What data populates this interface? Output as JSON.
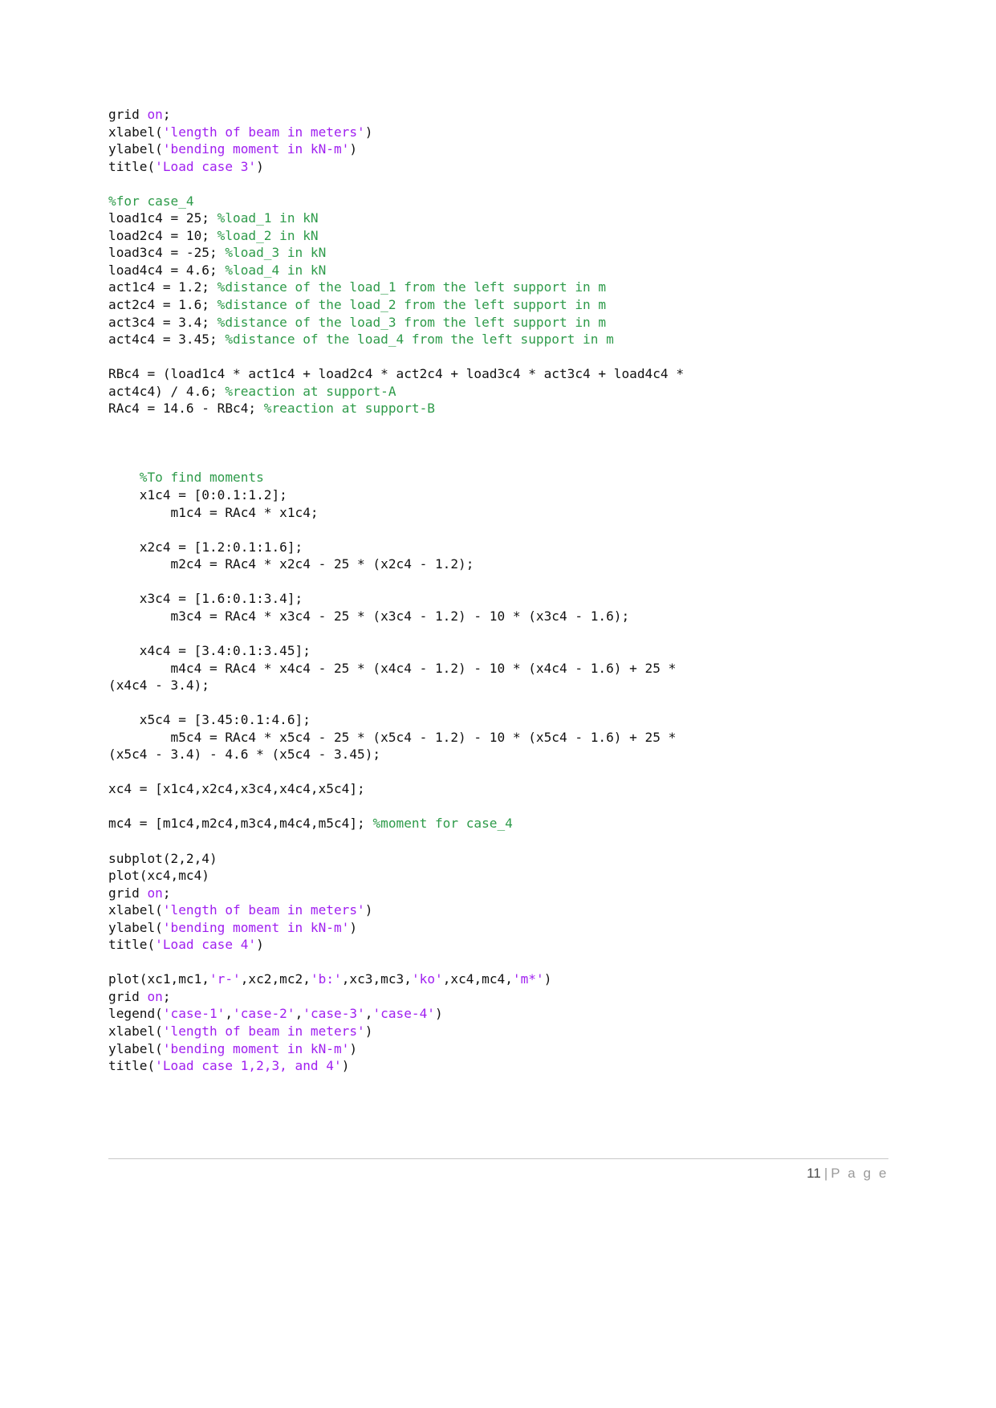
{
  "document": {
    "page_number": "11",
    "footer_separator": "|",
    "footer_label": "P a g e"
  },
  "code": {
    "language": "matlab",
    "lines": [
      {
        "id": "l1",
        "indent": 0,
        "segments": [
          {
            "t": "grid ",
            "c": "plain"
          },
          {
            "t": "on",
            "c": "kw"
          },
          {
            "t": ";",
            "c": "plain"
          }
        ]
      },
      {
        "id": "l2",
        "indent": 0,
        "segments": [
          {
            "t": "xlabel(",
            "c": "plain"
          },
          {
            "t": "'length of beam in meters'",
            "c": "str"
          },
          {
            "t": ")",
            "c": "plain"
          }
        ]
      },
      {
        "id": "l3",
        "indent": 0,
        "segments": [
          {
            "t": "ylabel(",
            "c": "plain"
          },
          {
            "t": "'bending moment in kN-m'",
            "c": "str"
          },
          {
            "t": ")",
            "c": "plain"
          }
        ]
      },
      {
        "id": "l4",
        "indent": 0,
        "segments": [
          {
            "t": "title(",
            "c": "plain"
          },
          {
            "t": "'Load case 3'",
            "c": "str"
          },
          {
            "t": ")",
            "c": "plain"
          }
        ]
      },
      {
        "id": "l5",
        "blank": true
      },
      {
        "id": "l6",
        "indent": 0,
        "segments": [
          {
            "t": "%for case_4",
            "c": "cmt"
          }
        ]
      },
      {
        "id": "l7",
        "indent": 0,
        "segments": [
          {
            "t": "load1c4 = 25; ",
            "c": "plain"
          },
          {
            "t": "%load_1 in kN",
            "c": "cmt"
          }
        ]
      },
      {
        "id": "l8",
        "indent": 0,
        "segments": [
          {
            "t": "load2c4 = 10; ",
            "c": "plain"
          },
          {
            "t": "%load_2 in kN",
            "c": "cmt"
          }
        ]
      },
      {
        "id": "l9",
        "indent": 0,
        "segments": [
          {
            "t": "load3c4 = -25; ",
            "c": "plain"
          },
          {
            "t": "%load_3 in kN",
            "c": "cmt"
          }
        ]
      },
      {
        "id": "l10",
        "indent": 0,
        "segments": [
          {
            "t": "load4c4 = 4.6; ",
            "c": "plain"
          },
          {
            "t": "%load_4 in kN",
            "c": "cmt"
          }
        ]
      },
      {
        "id": "l11",
        "indent": 0,
        "segments": [
          {
            "t": "act1c4 = 1.2; ",
            "c": "plain"
          },
          {
            "t": "%distance of the load_1 from the left support in m",
            "c": "cmt"
          }
        ]
      },
      {
        "id": "l12",
        "indent": 0,
        "segments": [
          {
            "t": "act2c4 = 1.6; ",
            "c": "plain"
          },
          {
            "t": "%distance of the load_2 from the left support in m",
            "c": "cmt"
          }
        ]
      },
      {
        "id": "l13",
        "indent": 0,
        "segments": [
          {
            "t": "act3c4 = 3.4; ",
            "c": "plain"
          },
          {
            "t": "%distance of the load_3 from the left support in m",
            "c": "cmt"
          }
        ]
      },
      {
        "id": "l14",
        "indent": 0,
        "segments": [
          {
            "t": "act4c4 = 3.45; ",
            "c": "plain"
          },
          {
            "t": "%distance of the load_4 from the left support in m",
            "c": "cmt"
          }
        ]
      },
      {
        "id": "l15",
        "blank": true
      },
      {
        "id": "l16",
        "indent": 0,
        "segments": [
          {
            "t": "RBc4 = (load1c4 * act1c4 + load2c4 * act2c4 + load3c4 * act3c4 + load4c4 *",
            "c": "plain"
          }
        ]
      },
      {
        "id": "l17",
        "indent": 0,
        "segments": [
          {
            "t": "act4c4) / 4.6; ",
            "c": "plain"
          },
          {
            "t": "%reaction at support-A",
            "c": "cmt"
          }
        ]
      },
      {
        "id": "l18",
        "indent": 0,
        "segments": [
          {
            "t": "RAc4 = 14.6 - RBc4; ",
            "c": "plain"
          },
          {
            "t": "%reaction at support-B",
            "c": "cmt"
          }
        ]
      },
      {
        "id": "l19",
        "blank": true
      },
      {
        "id": "l20",
        "blank": true
      },
      {
        "id": "l21",
        "blank": true
      },
      {
        "id": "l22",
        "indent": 0,
        "segments": [
          {
            "t": "    %To find moments",
            "c": "cmt"
          }
        ]
      },
      {
        "id": "l23",
        "indent": 0,
        "segments": [
          {
            "t": "    x1c4 = [0:0.1:1.2];",
            "c": "plain"
          }
        ]
      },
      {
        "id": "l24",
        "indent": 0,
        "segments": [
          {
            "t": "        m1c4 = RAc4 * x1c4;",
            "c": "plain"
          }
        ]
      },
      {
        "id": "l25",
        "blank": true
      },
      {
        "id": "l26",
        "indent": 0,
        "segments": [
          {
            "t": "    x2c4 = [1.2:0.1:1.6];",
            "c": "plain"
          }
        ]
      },
      {
        "id": "l27",
        "indent": 0,
        "segments": [
          {
            "t": "        m2c4 = RAc4 * x2c4 - 25 * (x2c4 - 1.2);",
            "c": "plain"
          }
        ]
      },
      {
        "id": "l28",
        "blank": true
      },
      {
        "id": "l29",
        "indent": 0,
        "segments": [
          {
            "t": "    x3c4 = [1.6:0.1:3.4];",
            "c": "plain"
          }
        ]
      },
      {
        "id": "l30",
        "indent": 0,
        "segments": [
          {
            "t": "        m3c4 = RAc4 * x3c4 - 25 * (x3c4 - 1.2) - 10 * (x3c4 - 1.6);",
            "c": "plain"
          }
        ]
      },
      {
        "id": "l31",
        "blank": true
      },
      {
        "id": "l32",
        "indent": 0,
        "segments": [
          {
            "t": "    x4c4 = [3.4:0.1:3.45];",
            "c": "plain"
          }
        ]
      },
      {
        "id": "l33",
        "indent": 0,
        "segments": [
          {
            "t": "        m4c4 = RAc4 * x4c4 - 25 * (x4c4 - 1.2) - 10 * (x4c4 - 1.6) + 25 *",
            "c": "plain"
          }
        ]
      },
      {
        "id": "l34",
        "indent": 0,
        "segments": [
          {
            "t": "(x4c4 - 3.4);",
            "c": "plain"
          }
        ]
      },
      {
        "id": "l35",
        "blank": true
      },
      {
        "id": "l36",
        "indent": 0,
        "segments": [
          {
            "t": "    x5c4 = [3.45:0.1:4.6];",
            "c": "plain"
          }
        ]
      },
      {
        "id": "l37",
        "indent": 0,
        "segments": [
          {
            "t": "        m5c4 = RAc4 * x5c4 - 25 * (x5c4 - 1.2) - 10 * (x5c4 - 1.6) + 25 *",
            "c": "plain"
          }
        ]
      },
      {
        "id": "l38",
        "indent": 0,
        "segments": [
          {
            "t": "(x5c4 - 3.4) - 4.6 * (x5c4 - 3.45);",
            "c": "plain"
          }
        ]
      },
      {
        "id": "l39",
        "blank": true
      },
      {
        "id": "l40",
        "indent": 0,
        "segments": [
          {
            "t": "xc4 = [x1c4,x2c4,x3c4,x4c4,x5c4];",
            "c": "plain"
          }
        ]
      },
      {
        "id": "l41",
        "blank": true
      },
      {
        "id": "l42",
        "indent": 0,
        "segments": [
          {
            "t": "mc4 = [m1c4,m2c4,m3c4,m4c4,m5c4]; ",
            "c": "plain"
          },
          {
            "t": "%moment for case_4",
            "c": "cmt"
          }
        ]
      },
      {
        "id": "l43",
        "blank": true
      },
      {
        "id": "l44",
        "indent": 0,
        "segments": [
          {
            "t": "subplot(2,2,4)",
            "c": "plain"
          }
        ]
      },
      {
        "id": "l45",
        "indent": 0,
        "segments": [
          {
            "t": "plot(xc4,mc4)",
            "c": "plain"
          }
        ]
      },
      {
        "id": "l46",
        "indent": 0,
        "segments": [
          {
            "t": "grid ",
            "c": "plain"
          },
          {
            "t": "on",
            "c": "kw"
          },
          {
            "t": ";",
            "c": "plain"
          }
        ]
      },
      {
        "id": "l47",
        "indent": 0,
        "segments": [
          {
            "t": "xlabel(",
            "c": "plain"
          },
          {
            "t": "'length of beam in meters'",
            "c": "str"
          },
          {
            "t": ")",
            "c": "plain"
          }
        ]
      },
      {
        "id": "l48",
        "indent": 0,
        "segments": [
          {
            "t": "ylabel(",
            "c": "plain"
          },
          {
            "t": "'bending moment in kN-m'",
            "c": "str"
          },
          {
            "t": ")",
            "c": "plain"
          }
        ]
      },
      {
        "id": "l49",
        "indent": 0,
        "segments": [
          {
            "t": "title(",
            "c": "plain"
          },
          {
            "t": "'Load case 4'",
            "c": "str"
          },
          {
            "t": ")",
            "c": "plain"
          }
        ]
      },
      {
        "id": "l50",
        "blank": true
      },
      {
        "id": "l51",
        "indent": 0,
        "segments": [
          {
            "t": "plot(xc1,mc1,",
            "c": "plain"
          },
          {
            "t": "'r-'",
            "c": "str"
          },
          {
            "t": ",xc2,mc2,",
            "c": "plain"
          },
          {
            "t": "'b:'",
            "c": "str"
          },
          {
            "t": ",xc3,mc3,",
            "c": "plain"
          },
          {
            "t": "'ko'",
            "c": "str"
          },
          {
            "t": ",xc4,mc4,",
            "c": "plain"
          },
          {
            "t": "'m*'",
            "c": "str"
          },
          {
            "t": ")",
            "c": "plain"
          }
        ]
      },
      {
        "id": "l52",
        "indent": 0,
        "segments": [
          {
            "t": "grid ",
            "c": "plain"
          },
          {
            "t": "on",
            "c": "kw"
          },
          {
            "t": ";",
            "c": "plain"
          }
        ]
      },
      {
        "id": "l53",
        "indent": 0,
        "segments": [
          {
            "t": "legend(",
            "c": "plain"
          },
          {
            "t": "'case-1'",
            "c": "str"
          },
          {
            "t": ",",
            "c": "plain"
          },
          {
            "t": "'case-2'",
            "c": "str"
          },
          {
            "t": ",",
            "c": "plain"
          },
          {
            "t": "'case-3'",
            "c": "str"
          },
          {
            "t": ",",
            "c": "plain"
          },
          {
            "t": "'case-4'",
            "c": "str"
          },
          {
            "t": ")",
            "c": "plain"
          }
        ]
      },
      {
        "id": "l54",
        "indent": 0,
        "segments": [
          {
            "t": "xlabel(",
            "c": "plain"
          },
          {
            "t": "'length of beam in meters'",
            "c": "str"
          },
          {
            "t": ")",
            "c": "plain"
          }
        ]
      },
      {
        "id": "l55",
        "indent": 0,
        "segments": [
          {
            "t": "ylabel(",
            "c": "plain"
          },
          {
            "t": "'bending moment in kN-m'",
            "c": "str"
          },
          {
            "t": ")",
            "c": "plain"
          }
        ]
      },
      {
        "id": "l56",
        "indent": 0,
        "segments": [
          {
            "t": "title(",
            "c": "plain"
          },
          {
            "t": "'Load case 1,2,3, and 4'",
            "c": "str"
          },
          {
            "t": ")",
            "c": "plain"
          }
        ]
      }
    ]
  },
  "colors": {
    "comment": "#2e9b4a",
    "string": "#a020f0",
    "keyword": "#a020f0",
    "text": "#111111",
    "page_background": "#ffffff",
    "footer_rule": "#c8c8c8"
  }
}
